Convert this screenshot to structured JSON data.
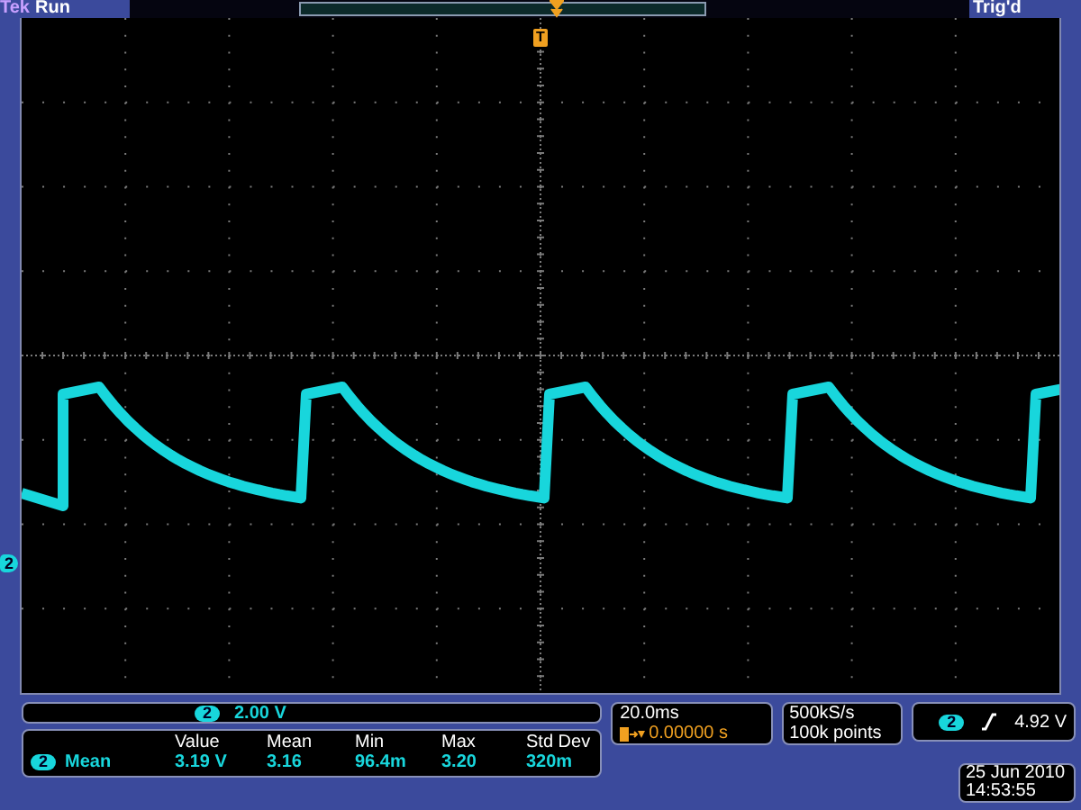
{
  "top_bar": {
    "brand": "Tek",
    "state": "Run",
    "trigger_status": "Trig'd"
  },
  "trigger_marker": "T",
  "channel_marker": "2",
  "channel_scale": {
    "channel": "2",
    "value": "2.00 V"
  },
  "measurements": {
    "columns": [
      "Value",
      "Mean",
      "Min",
      "Max",
      "Std Dev"
    ],
    "rows": [
      {
        "channel": "2",
        "name": "Mean",
        "cells": [
          "3.19 V",
          "3.16",
          "96.4m",
          "3.20",
          "320m"
        ]
      }
    ]
  },
  "timebase": {
    "scale": "20.0ms",
    "delay": "0.00000 s"
  },
  "acquisition": {
    "sample_rate": "500kS/s",
    "record_length": "100k points"
  },
  "trigger": {
    "channel": "2",
    "value": "4.92 V"
  },
  "datetime": {
    "date": "25 Jun  2010",
    "time": "14:53:55"
  }
}
